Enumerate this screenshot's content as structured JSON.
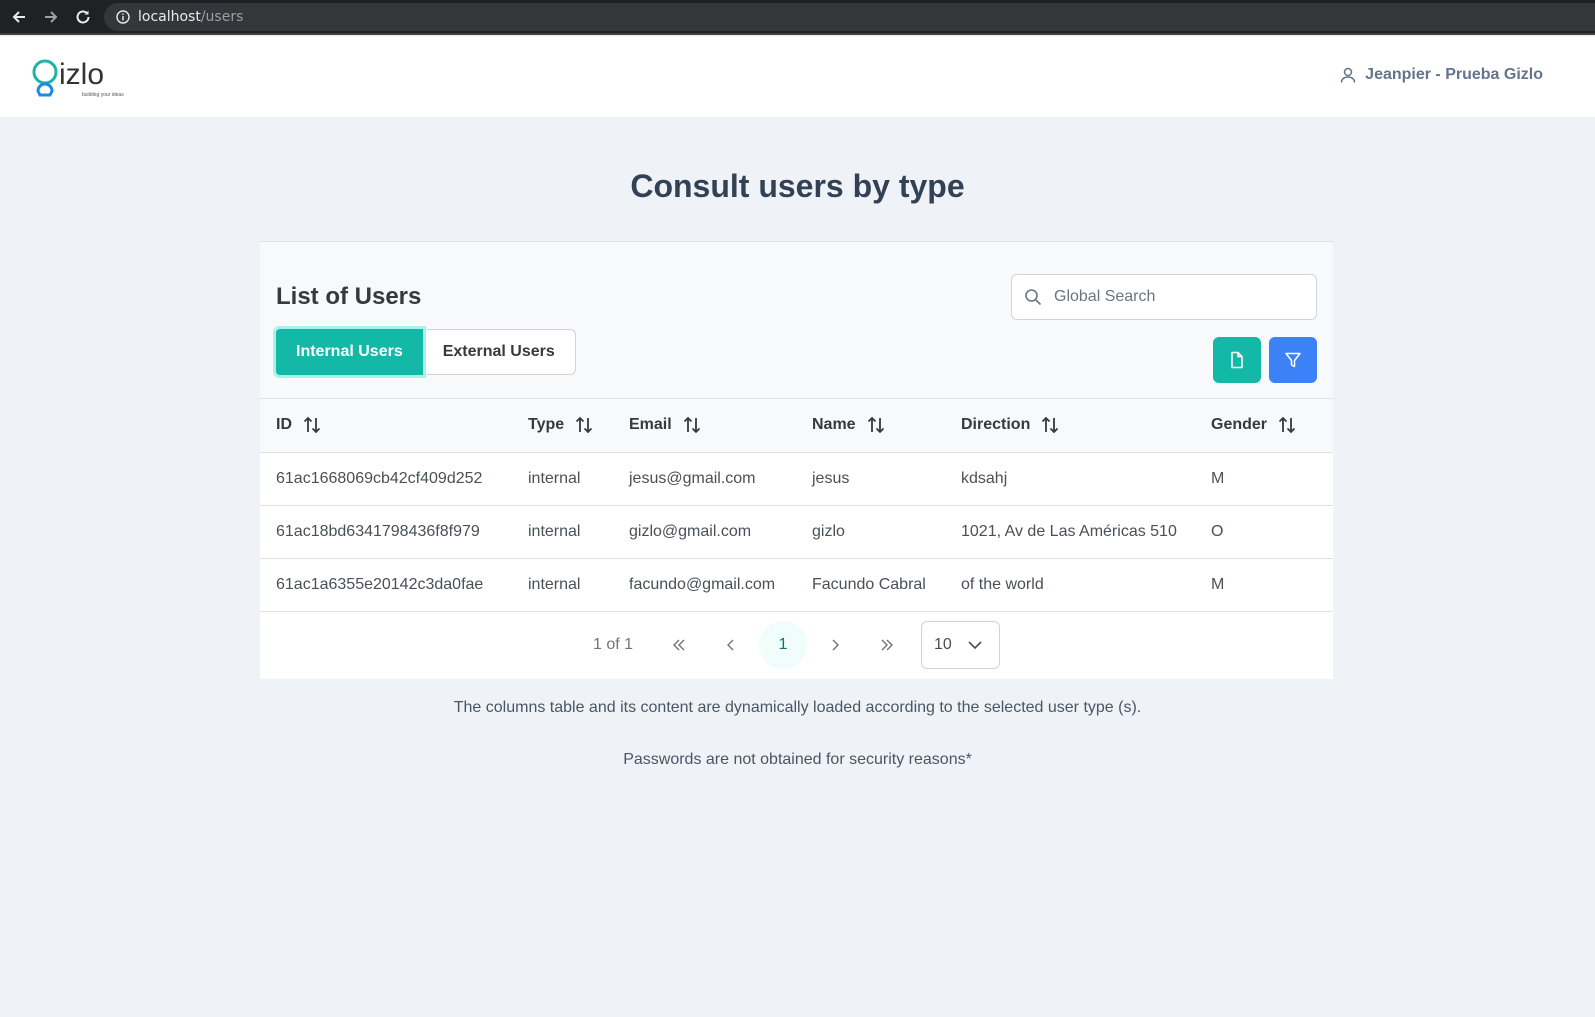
{
  "browser": {
    "url_host": "localhost",
    "url_path": "/users"
  },
  "header": {
    "logo_text": "gizlo",
    "logo_tagline": "building your ideas",
    "user_name": "Jeanpier - Prueba Gizlo"
  },
  "page": {
    "title": "Consult users by type"
  },
  "card": {
    "list_title": "List of Users",
    "tabs": [
      {
        "label": "Internal Users",
        "active": true
      },
      {
        "label": "External Users",
        "active": false
      }
    ],
    "search_placeholder": "Global Search",
    "columns": [
      "ID",
      "Type",
      "Email",
      "Name",
      "Direction",
      "Gender"
    ],
    "rows": [
      [
        "61ac1668069cb42cf409d252",
        "internal",
        "jesus@gmail.com",
        "jesus",
        "kdsahj",
        "M"
      ],
      [
        "61ac18bd6341798436f8f979",
        "internal",
        "gizlo@gmail.com",
        "gizlo",
        "1021, Av de Las Américas 510",
        "O"
      ],
      [
        "61ac1a6355e20142c3da0fae",
        "internal",
        "facundo@gmail.com",
        "Facundo Cabral",
        "of the world",
        "M"
      ]
    ]
  },
  "pagination": {
    "report": "1 of 1",
    "current_page": "1",
    "rows_per_page": "10"
  },
  "notes": {
    "dynamic": "The columns table and its content are dynamically loaded according to the selected user type (s).",
    "passwords": "Passwords are not obtained for security reasons*"
  },
  "colors": {
    "teal": "#14b8a6",
    "blue": "#3b82f6",
    "page_bg": "#eff3f8"
  },
  "icons": {
    "back": "arrow-left-icon",
    "forward": "arrow-right-icon",
    "reload": "reload-icon",
    "site_info": "info-icon",
    "user": "user-icon",
    "search": "search-icon",
    "export": "file-icon",
    "filter": "filter-icon",
    "sort": "sort-icon"
  }
}
